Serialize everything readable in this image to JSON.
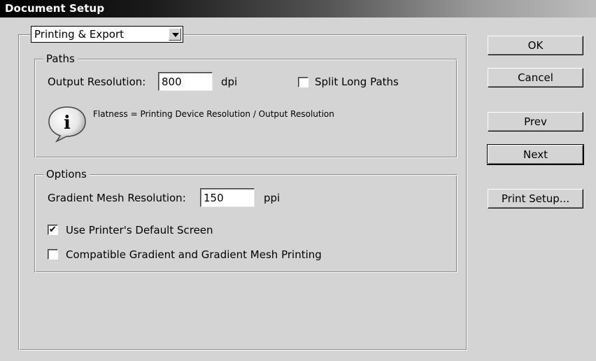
{
  "window": {
    "title": "Document Setup"
  },
  "category_dropdown": {
    "selected": "Printing & Export"
  },
  "paths": {
    "legend": "Paths",
    "output_resolution_label": "Output Resolution:",
    "output_resolution_value": "800",
    "output_resolution_unit": "dpi",
    "split_long_paths_label": "Split Long Paths",
    "split_long_paths_checked": false,
    "info_text": "Flatness = Printing Device Resolution / Output Resolution"
  },
  "options": {
    "legend": "Options",
    "gradient_mesh_label": "Gradient Mesh Resolution:",
    "gradient_mesh_value": "150",
    "gradient_mesh_unit": "ppi",
    "use_printer_default_label": "Use Printer's Default Screen",
    "use_printer_default_checked": true,
    "compatible_gradient_label": "Compatible Gradient and Gradient Mesh Printing",
    "compatible_gradient_checked": false
  },
  "buttons": {
    "ok": "OK",
    "cancel": "Cancel",
    "prev": "Prev",
    "next": "Next",
    "print_setup": "Print Setup..."
  },
  "icons": {
    "info": "info-speech-bubble-icon",
    "dropdown": "chevron-down-icon",
    "check": "checkmark-icon"
  }
}
